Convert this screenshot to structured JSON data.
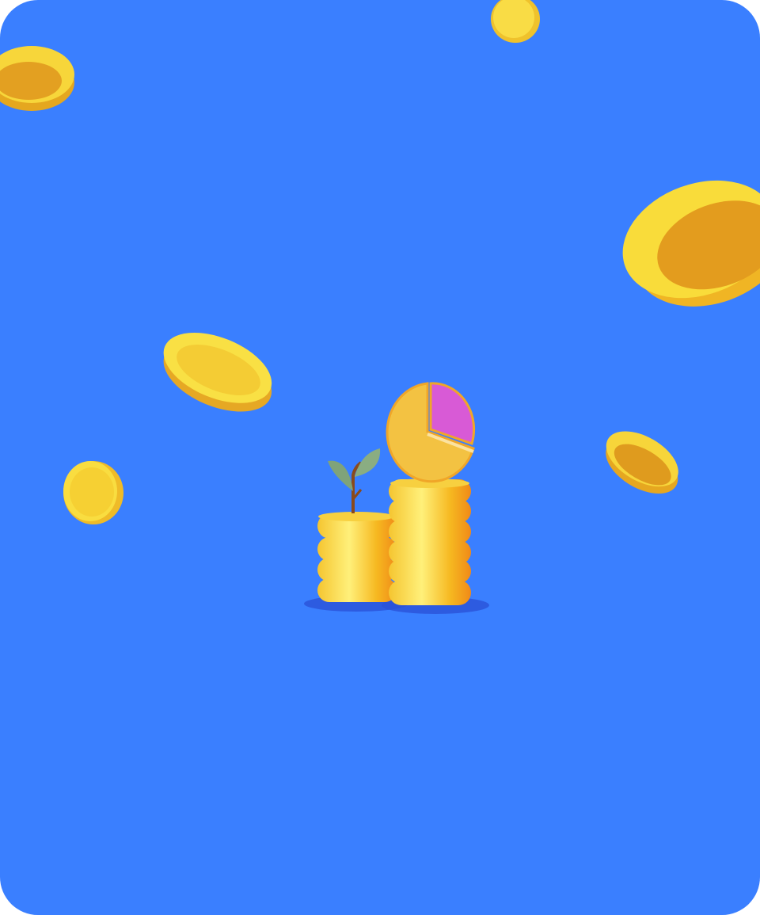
{
  "colors": {
    "background": "#3a7fff",
    "coin_light": "#f9dc3a",
    "coin_dark": "#e0a21c",
    "pie_main": "#f3c242",
    "pie_slice": "#d85ad6",
    "leaf": "#7fa37a",
    "shadow": "#2a52d8"
  },
  "illustration": {
    "icon": "coins-growth-pie-chart"
  }
}
